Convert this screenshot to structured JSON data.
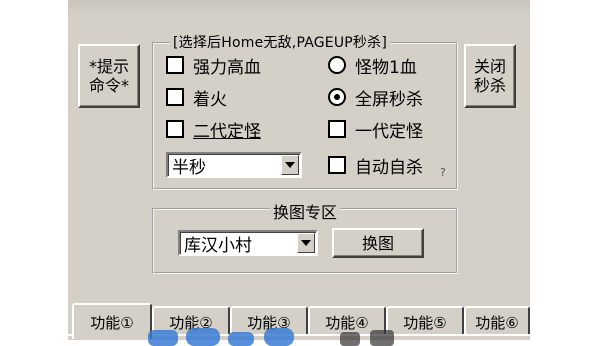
{
  "left_button": {
    "label": "*提示\n命令*"
  },
  "right_button": {
    "label": "关闭\n秒杀"
  },
  "main_group": {
    "legend": "[选择后Home无敌,PAGEUP秒杀]",
    "left_options": [
      {
        "label": "强力高血",
        "checked": false
      },
      {
        "label": "着火",
        "checked": false
      },
      {
        "label": "二代定怪",
        "checked": false
      }
    ],
    "right_options": [
      {
        "label": "怪物1血",
        "type": "radio",
        "checked": false
      },
      {
        "label": "全屏秒杀",
        "type": "radio",
        "checked": true
      },
      {
        "label": "一代定怪",
        "type": "checkbox",
        "checked": false
      },
      {
        "label": "自动自杀",
        "type": "checkbox",
        "checked": false
      }
    ],
    "speed_select": {
      "value": "半秒"
    },
    "corner_mark": "?"
  },
  "map_group": {
    "legend": "换图专区",
    "map_select": {
      "value": "库汉小村"
    },
    "go_button": "换图"
  },
  "tabs": [
    {
      "label": "功能①",
      "active": true
    },
    {
      "label": "功能②",
      "active": false
    },
    {
      "label": "功能③",
      "active": false
    },
    {
      "label": "功能④",
      "active": false
    },
    {
      "label": "功能⑤",
      "active": false
    },
    {
      "label": "功能⑥",
      "active": false
    }
  ],
  "colors": {
    "face": "#d4d0c8",
    "watermark": "#3a7bd5"
  }
}
